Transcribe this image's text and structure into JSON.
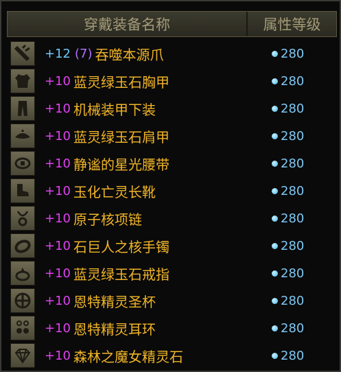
{
  "header": {
    "name_label": "穿戴装备名称",
    "level_label": "属性等级"
  },
  "colors": {
    "enhance_magenta": "#e040f0",
    "enhance_blue": "#6ec8f8",
    "amplify_purple": "#b070ff",
    "item_gold": "#f0b428",
    "level_blue": "#7ec8f4"
  },
  "items": [
    {
      "icon": "weapon-claw-icon",
      "enhance": "+12",
      "amplify": "(7)",
      "name": "吞噬本源爪",
      "level": "280"
    },
    {
      "icon": "chest-armor-icon",
      "enhance": "+10",
      "name": "蓝灵绿玉石胸甲",
      "level": "280"
    },
    {
      "icon": "pants-icon",
      "enhance": "+10",
      "name": "机械装甲下装",
      "level": "280"
    },
    {
      "icon": "shoulder-icon",
      "enhance": "+10",
      "name": "蓝灵绿玉石肩甲",
      "level": "280"
    },
    {
      "icon": "belt-icon",
      "enhance": "+10",
      "name": "静谧的星光腰带",
      "level": "280"
    },
    {
      "icon": "boots-icon",
      "enhance": "+10",
      "name": "玉化亡灵长靴",
      "level": "280"
    },
    {
      "icon": "necklace-icon",
      "enhance": "+10",
      "name": "原子核项链",
      "level": "280"
    },
    {
      "icon": "bracelet-icon",
      "enhance": "+10",
      "name": "石巨人之核手镯",
      "level": "280"
    },
    {
      "icon": "ring-icon",
      "enhance": "+10",
      "name": "蓝灵绿玉石戒指",
      "level": "280"
    },
    {
      "icon": "cup-icon",
      "enhance": "+10",
      "name": "恩特精灵圣杯",
      "level": "280"
    },
    {
      "icon": "earring-icon",
      "enhance": "+10",
      "name": "恩特精灵耳环",
      "level": "280"
    },
    {
      "icon": "gem-stone-icon",
      "enhance": "+10",
      "name": "森林之魔女精灵石",
      "level": "280"
    }
  ]
}
